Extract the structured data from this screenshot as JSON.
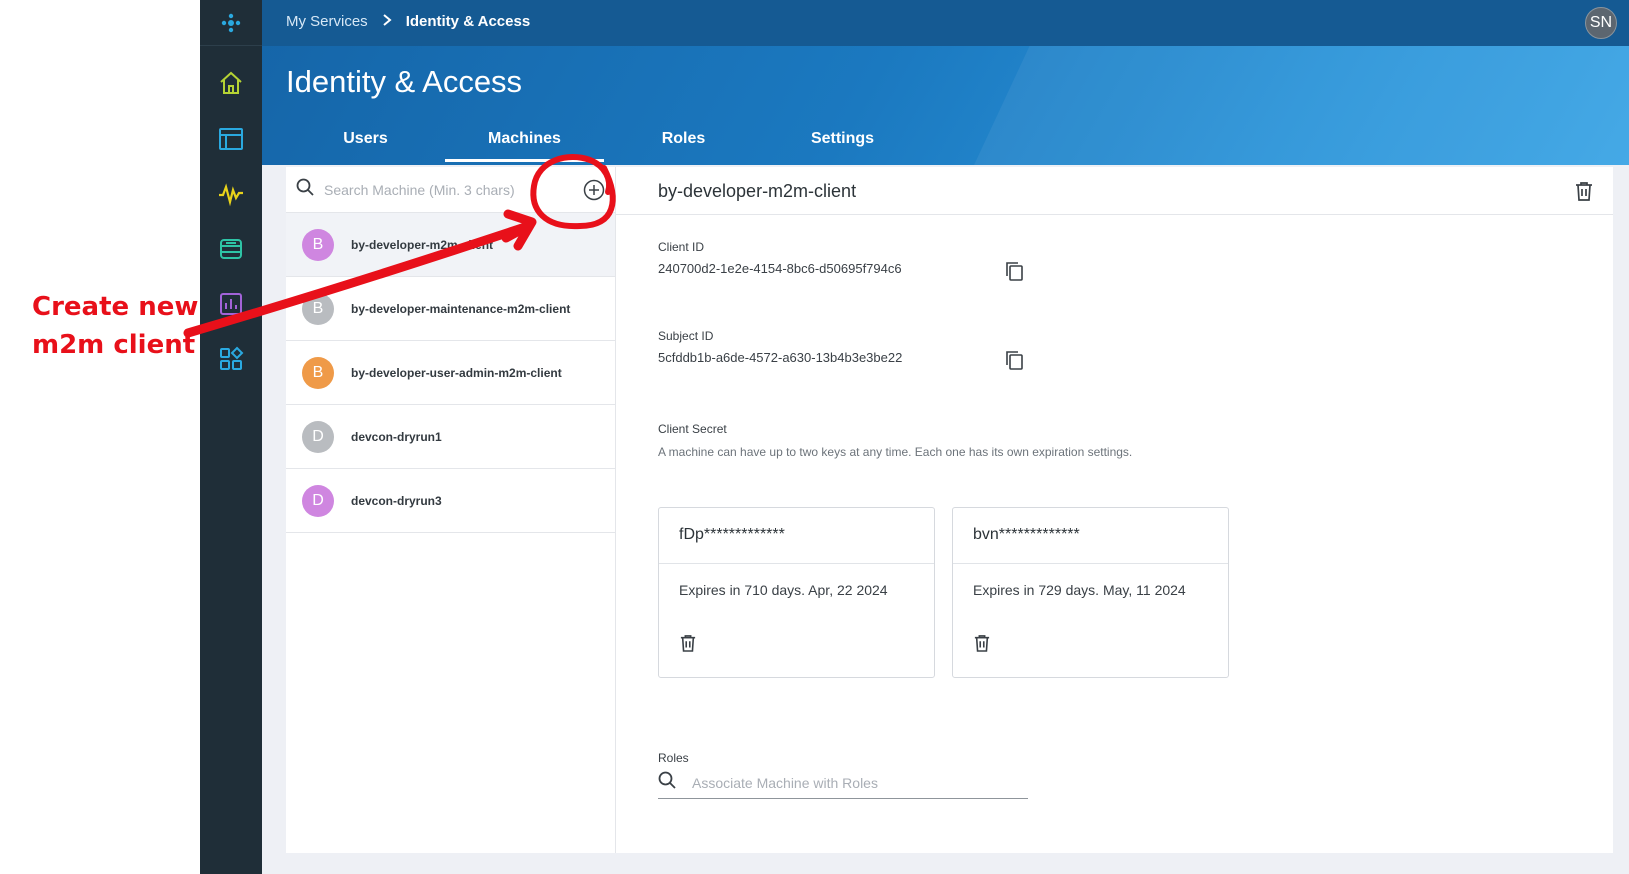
{
  "annotation": {
    "line1": "Create new",
    "line2": "m2m client"
  },
  "rail": {
    "items": [
      {
        "icon": "home-icon",
        "color": "#b5d334"
      },
      {
        "icon": "layout-icon",
        "color": "#2aa9e0"
      },
      {
        "icon": "pulse-icon",
        "color": "#e8d31b"
      },
      {
        "icon": "database-icon",
        "color": "#2ec4a6"
      },
      {
        "icon": "analytics-icon",
        "color": "#a263d8"
      },
      {
        "icon": "apps-icon",
        "color": "#2aa9e0"
      }
    ]
  },
  "header": {
    "breadcrumb_root": "My Services",
    "breadcrumb_current": "Identity & Access",
    "user_initials": "SN",
    "page_title": "Identity & Access",
    "tabs": [
      "Users",
      "Machines",
      "Roles",
      "Settings"
    ],
    "active_tab": "Machines"
  },
  "machine_list": {
    "search_placeholder": "Search Machine (Min. 3 chars)",
    "items": [
      {
        "initial": "B",
        "label": "by-developer-m2m-client",
        "color": "#cf86e0",
        "selected": true
      },
      {
        "initial": "B",
        "label": "by-developer-maintenance-m2m-client",
        "color": "#b9bcc0",
        "selected": false
      },
      {
        "initial": "B",
        "label": "by-developer-user-admin-m2m-client",
        "color": "#ef9a48",
        "selected": false
      },
      {
        "initial": "D",
        "label": "devcon-dryrun1",
        "color": "#b9bcc0",
        "selected": false
      },
      {
        "initial": "D",
        "label": "devcon-dryrun3",
        "color": "#cf86e0",
        "selected": false
      }
    ]
  },
  "detail": {
    "title": "by-developer-m2m-client",
    "client_id_label": "Client ID",
    "client_id": "240700d2-1e2e-4154-8bc6-d50695f794c6",
    "subject_id_label": "Subject ID",
    "subject_id": "5cfddb1b-a6de-4572-a630-13b4b3e3be22",
    "client_secret_label": "Client Secret",
    "client_secret_note": "A machine can have up to two keys at any time. Each one has its own expiration settings.",
    "keys": [
      {
        "masked": "fDp*************",
        "expires": "Expires in 710 days. Apr, 22 2024"
      },
      {
        "masked": "bvn*************",
        "expires": "Expires in 729 days. May, 11 2024"
      }
    ],
    "roles_label": "Roles",
    "roles_placeholder": "Associate Machine with Roles"
  }
}
